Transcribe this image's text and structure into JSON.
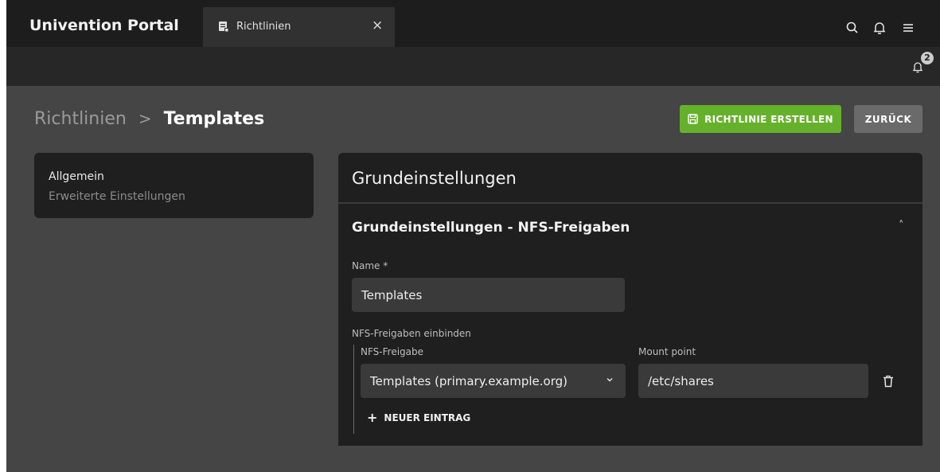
{
  "topbar": {
    "brand": "Univention Portal",
    "tab_label": "Richtlinien",
    "tab_close": "×",
    "icons": [
      "search-icon",
      "bell-icon",
      "menu-icon"
    ]
  },
  "notifications": {
    "count": "2"
  },
  "breadcrumb": {
    "parent": "Richtlinien",
    "separator": ">",
    "current": "Templates"
  },
  "actions": {
    "create_label": "RICHTLINIE ERSTELLEN",
    "back_label": "ZURÜCK"
  },
  "sidenav": {
    "items": [
      {
        "label": "Allgemein"
      },
      {
        "label": "Erweiterte Einstellungen"
      }
    ]
  },
  "panel": {
    "title": "Grundeinstellungen",
    "section_title": "Grundeinstellungen - NFS-Freigaben",
    "toggle": "˄",
    "name_label": "Name *",
    "name_value": "Templates",
    "nfs_group_label": "NFS-Freigaben einbinden",
    "nfs_share_label": "NFS-Freigabe",
    "mount_point_label": "Mount point",
    "nfs_share_value": "Templates (primary.example.org)",
    "mount_point_value": "/etc/shares",
    "add_entry_label": "NEUER EINTRAG",
    "add_entry_plus": "+"
  },
  "colors": {
    "accent": "#66b12b",
    "background": "#454545",
    "panel": "#1f1f1f"
  }
}
